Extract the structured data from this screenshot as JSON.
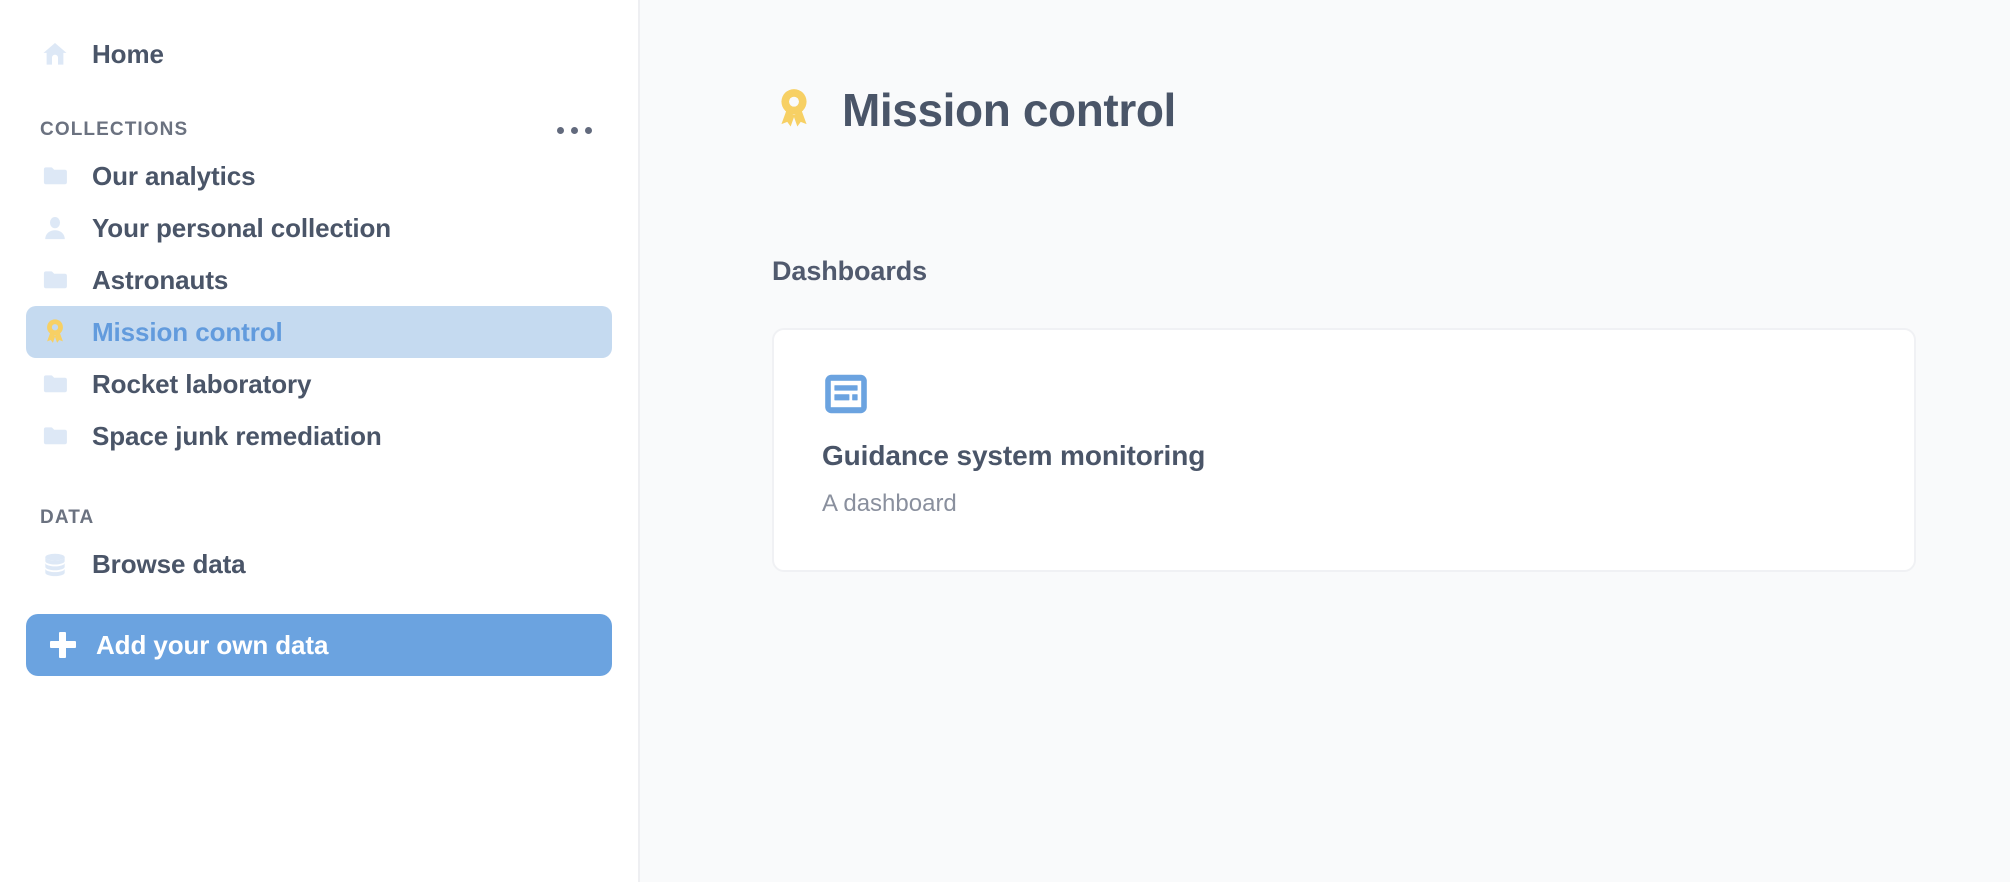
{
  "sidebar": {
    "home": {
      "label": "Home",
      "icon": "home-icon"
    },
    "collections_section": {
      "title": "COLLECTIONS",
      "menu_icon": "ellipsis-icon",
      "items": [
        {
          "label": "Our analytics",
          "icon": "folder-icon",
          "selected": false
        },
        {
          "label": "Your personal collection",
          "icon": "person-icon",
          "selected": false
        },
        {
          "label": "Astronauts",
          "icon": "folder-icon",
          "selected": false
        },
        {
          "label": "Mission control",
          "icon": "badge-icon",
          "selected": true
        },
        {
          "label": "Rocket laboratory",
          "icon": "folder-icon",
          "selected": false
        },
        {
          "label": "Space junk remediation",
          "icon": "folder-icon",
          "selected": false
        }
      ]
    },
    "data_section": {
      "title": "DATA",
      "items": [
        {
          "label": "Browse data",
          "icon": "database-icon"
        }
      ]
    },
    "add_data_button": {
      "label": "Add your own data",
      "icon": "plus-icon"
    }
  },
  "main": {
    "page_title": "Mission control",
    "page_title_icon": "badge-icon",
    "section_label": "Dashboards",
    "cards": [
      {
        "title": "Guidance system monitoring",
        "subtitle": "A dashboard",
        "icon": "dashboard-icon"
      }
    ]
  },
  "colors": {
    "accent_blue": "#629bdd",
    "button_blue": "#6ba3e0",
    "selected_row_bg": "#c5daf0",
    "icon_light_blue": "#dde8f6",
    "badge_yellow": "#f7d064",
    "text_dark": "#4a5568",
    "text_muted": "#8a909e",
    "main_bg": "#f9fafb"
  }
}
